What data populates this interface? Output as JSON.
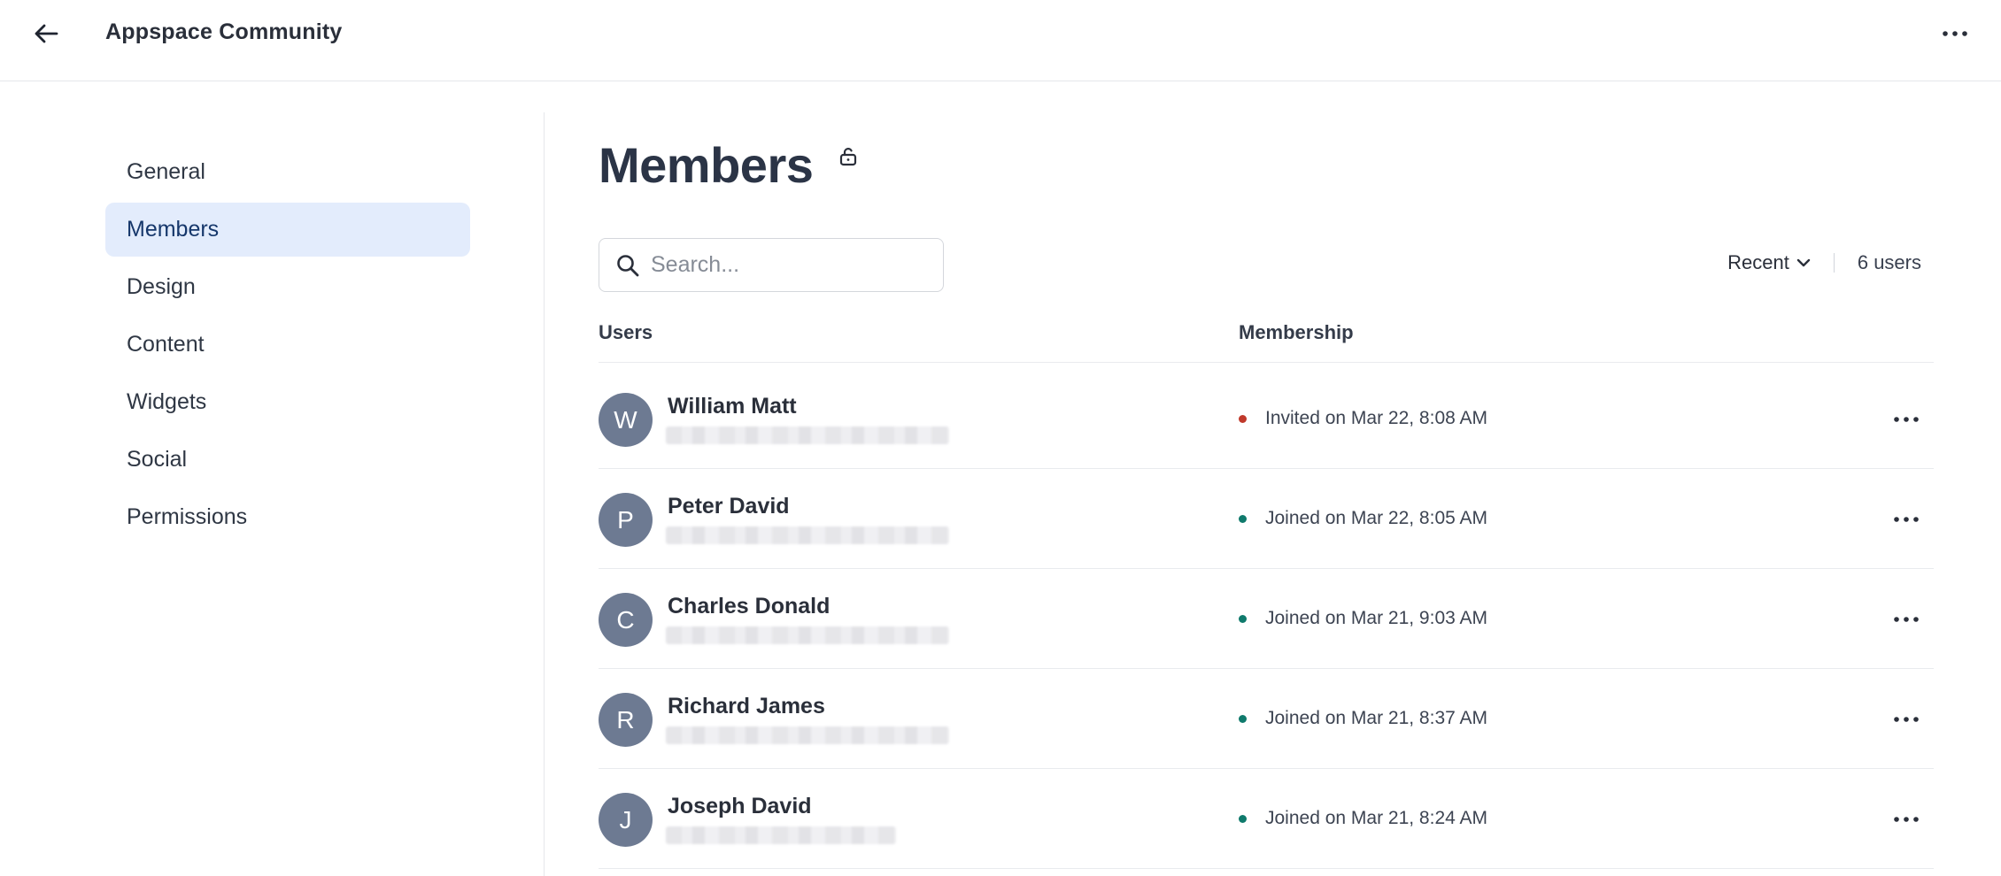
{
  "app": {
    "title": "Appspace Community"
  },
  "sidebar": {
    "items": [
      {
        "label": "General",
        "active": false
      },
      {
        "label": "Members",
        "active": true
      },
      {
        "label": "Design",
        "active": false
      },
      {
        "label": "Content",
        "active": false
      },
      {
        "label": "Widgets",
        "active": false
      },
      {
        "label": "Social",
        "active": false
      },
      {
        "label": "Permissions",
        "active": false
      }
    ]
  },
  "main": {
    "title": "Members",
    "search": {
      "placeholder": "Search...",
      "value": ""
    },
    "sort": {
      "label": "Recent"
    },
    "count": "6 users",
    "columns": {
      "users": "Users",
      "membership": "Membership"
    },
    "rows": [
      {
        "initial": "W",
        "name": "William Matt",
        "status": "Invited on Mar 22, 8:08 AM",
        "status_color": "#c0392b"
      },
      {
        "initial": "P",
        "name": "Peter David",
        "status": "Joined on Mar 22, 8:05 AM",
        "status_color": "#0f7a6c"
      },
      {
        "initial": "C",
        "name": "Charles Donald",
        "status": "Joined on Mar 21, 9:03 AM",
        "status_color": "#0f7a6c"
      },
      {
        "initial": "R",
        "name": "Richard James",
        "status": "Joined on Mar 21, 8:37 AM",
        "status_color": "#0f7a6c"
      },
      {
        "initial": "J",
        "name": "Joseph David",
        "status": "Joined on Mar 21, 8:24 AM",
        "status_color": "#0f7a6c"
      }
    ]
  },
  "colors": {
    "accent_bg": "#e3ecfc",
    "accent_text": "#16376b",
    "avatar_bg": "#6d7a92",
    "invited": "#c0392b",
    "joined": "#0f7a6c"
  },
  "icons": {
    "back": "arrow-left-icon",
    "more": "more-horizontal-icon",
    "lock": "unlock-icon",
    "search": "search-icon",
    "chevron": "chevron-down-icon"
  }
}
